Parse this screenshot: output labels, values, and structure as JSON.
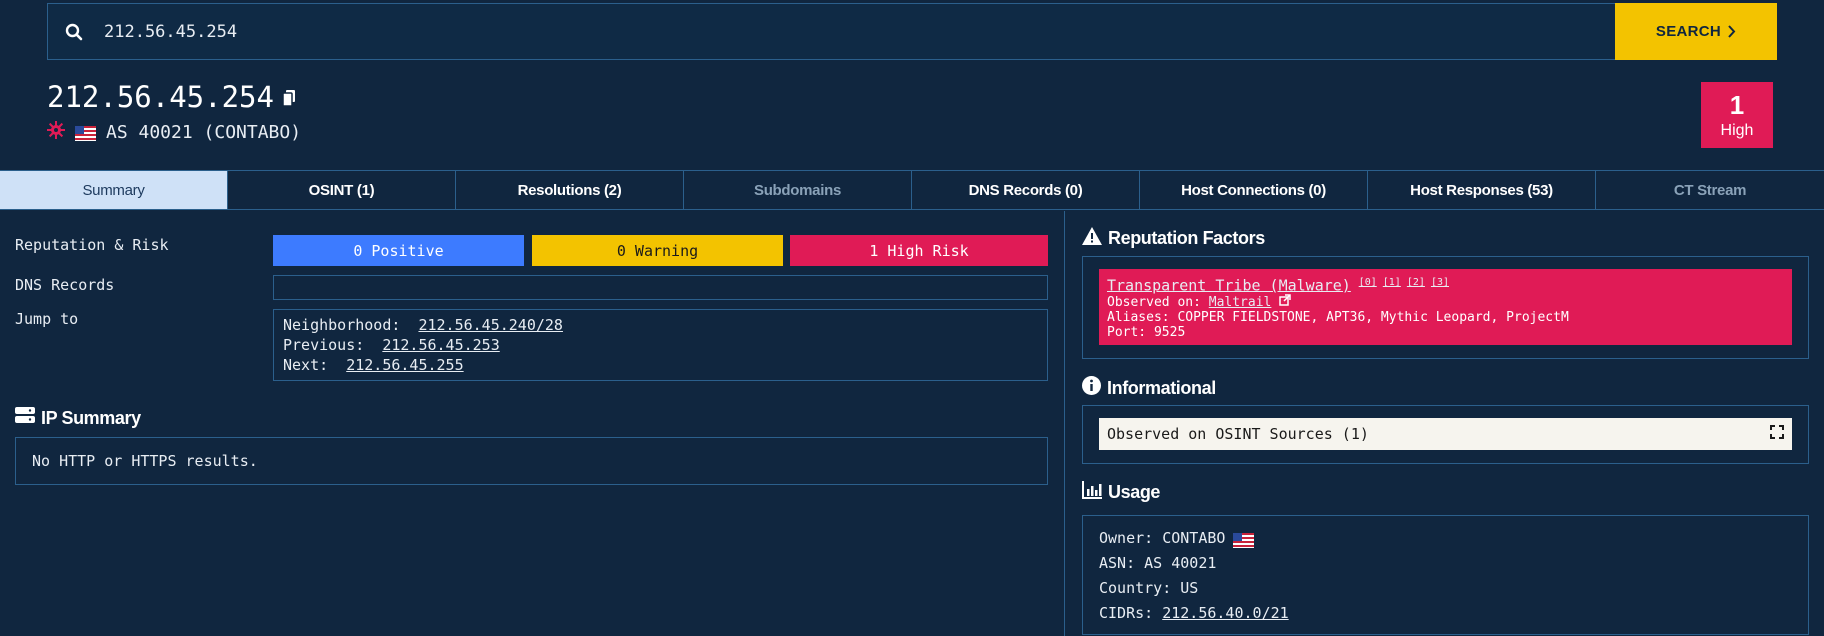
{
  "search": {
    "value": "212.56.45.254",
    "button_label": "SEARCH"
  },
  "header": {
    "ip": "212.56.45.254",
    "asn_text": "AS 40021 (CONTABO)",
    "risk_count": "1",
    "risk_level": "High"
  },
  "tabs": [
    {
      "label": "Summary"
    },
    {
      "label": "OSINT (1)"
    },
    {
      "label": "Resolutions (2)"
    },
    {
      "label": "Subdomains"
    },
    {
      "label": "DNS Records (0)"
    },
    {
      "label": "Host Connections (0)"
    },
    {
      "label": "Host Responses (53)"
    },
    {
      "label": "CT Stream"
    }
  ],
  "summary": {
    "reputation_label": "Reputation & Risk",
    "positive": "0 Positive",
    "warning": "0 Warning",
    "high_risk": "1 High Risk",
    "dns_label": "DNS Records",
    "jump_label": "Jump to",
    "neighborhood_label": "Neighborhood:",
    "neighborhood_value": "212.56.45.240/28",
    "previous_label": "Previous:",
    "previous_value": "212.56.45.253",
    "next_label": "Next:",
    "next_value": "212.56.45.255"
  },
  "ip_summary": {
    "title": "IP Summary",
    "message": "No HTTP or HTTPS results."
  },
  "reputation_factors": {
    "title": "Reputation Factors",
    "name": "Transparent Tribe (Malware)",
    "refs": [
      "[0]",
      "[1]",
      "[2]",
      "[3]"
    ],
    "observed_label": "Observed on:",
    "observed_source": "Maltrail",
    "aliases": "Aliases: COPPER FIELDSTONE, APT36, Mythic Leopard, ProjectM",
    "port": "Port: 9525"
  },
  "informational": {
    "title": "Informational",
    "item": "Observed on OSINT Sources (1)"
  },
  "usage": {
    "title": "Usage",
    "owner": "Owner: CONTABO",
    "asn": "ASN: AS 40021",
    "country": "Country: US",
    "cidrs_label": "CIDRs:",
    "cidrs_value": "212.56.40.0/21"
  },
  "colors": {
    "accent_yellow": "#f3c300",
    "danger": "#e01b56",
    "positive": "#3d7bff",
    "background": "#10263f",
    "border": "#2b5f8c"
  }
}
